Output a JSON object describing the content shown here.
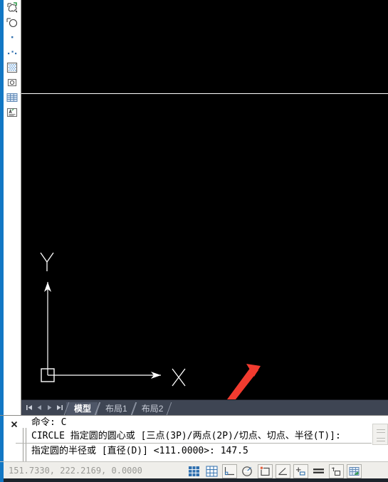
{
  "app": {
    "name": "AutoCAD",
    "accent_color": "#1277c4",
    "canvas_color": "#000000",
    "crosshair_color": "#ffffff"
  },
  "draw_toolbar": {
    "name": "Draw toolbar",
    "items": [
      {
        "icon": "revision-cloud-icon",
        "label": "修订云线"
      },
      {
        "icon": "region-icon",
        "label": "面域"
      },
      {
        "icon": "point-icon",
        "label": "点"
      },
      {
        "icon": "divide-points-icon",
        "label": "定数等分"
      },
      {
        "icon": "hatch-icon",
        "label": "图案填充"
      },
      {
        "icon": "gradient-icon",
        "label": "渐变色"
      },
      {
        "icon": "table-icon",
        "label": "表格"
      },
      {
        "icon": "multiline-text-icon",
        "label": "多行文字"
      }
    ]
  },
  "canvas": {
    "ucs": {
      "x_label": "X",
      "y_label": "Y",
      "origin_marker": "square"
    },
    "annotation": {
      "type": "double-headed-arrow",
      "color": "#f23b2f"
    }
  },
  "tabbar": {
    "nav": [
      {
        "icon": "first-tab-icon",
        "label": "第一个"
      },
      {
        "icon": "prev-tab-icon",
        "label": "上一个"
      },
      {
        "icon": "next-tab-icon",
        "label": "下一个"
      },
      {
        "icon": "last-tab-icon",
        "label": "最后一个"
      }
    ],
    "tabs": [
      {
        "label": "模型",
        "active": true
      },
      {
        "label": "布局1",
        "active": false
      },
      {
        "label": "布局2",
        "active": false
      }
    ]
  },
  "command_window": {
    "close_icon": "close-icon",
    "lines": [
      "命令: C",
      "CIRCLE 指定圆的圆心或 [三点(3P)/两点(2P)/切点、切点、半径(T)]:",
      "指定圆的半径或 [直径(D)] <111.0000>: 147.5"
    ]
  },
  "statusbar": {
    "coordinates": "151.7330,  222.2169,  0.0000",
    "toggles": [
      {
        "icon": "snap-grid-icon",
        "label": "捕捉",
        "active": true
      },
      {
        "icon": "grid-icon",
        "label": "栅格",
        "active": false
      },
      {
        "icon": "ortho-icon",
        "label": "正交",
        "active": false
      },
      {
        "icon": "polar-tracking-icon",
        "label": "极轴",
        "active": false
      },
      {
        "icon": "object-snap-icon",
        "label": "对象捕捉",
        "active": false
      },
      {
        "icon": "object-snap-tracking-icon",
        "label": "对象追踪",
        "active": false
      },
      {
        "icon": "dynamic-ucs-icon",
        "label": "允许/禁止动态 UCS",
        "active": false
      },
      {
        "icon": "dynamic-input-icon",
        "label": "动态输入",
        "active": false
      },
      {
        "icon": "lineweight-icon",
        "label": "线宽",
        "active": false
      },
      {
        "icon": "quick-properties-icon",
        "label": "快捷特性",
        "active": false
      },
      {
        "icon": "model-paper-space-icon",
        "label": "模型/图纸空间",
        "active": false
      }
    ]
  }
}
